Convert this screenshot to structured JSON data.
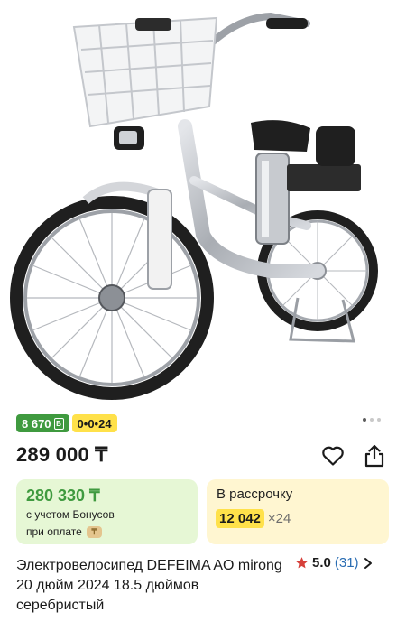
{
  "badges": {
    "bonus": "8 670",
    "bonus_currency": "Б",
    "installment": "0•0•24"
  },
  "carousel": {
    "count": 3,
    "active": 1
  },
  "price": "289 000 ₸",
  "bonus_card": {
    "price": "280 330 ₸",
    "line1": "с учетом Бонусов",
    "line2": "при оплате",
    "pay_glyph": "₸"
  },
  "installment_card": {
    "label": "В рассрочку",
    "amount": "12 042",
    "months": "×24"
  },
  "product": {
    "title": "Электровелосипед DEFEIMA AO mirong 20 дюйм 2024 18.5 дюймов серебристый"
  },
  "rating": {
    "value": "5.0",
    "count": "(31)"
  },
  "colors": {
    "bonus_green": "#3f9a3f",
    "installment_yellow": "#ffe14a",
    "bonus_card_bg": "#e6f7d5",
    "installment_card_bg": "#fff6d1",
    "star": "#d6403a",
    "link_blue": "#2a6db3"
  },
  "icons": [
    "favorite-heart-icon",
    "share-icon",
    "star-icon",
    "chevron-right-icon",
    "bonus-coin-icon"
  ]
}
